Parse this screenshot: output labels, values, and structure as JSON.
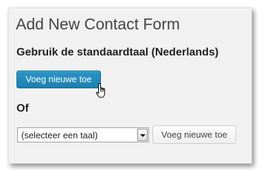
{
  "form": {
    "title": "Add New Contact Form",
    "default_language_label": "Gebruik de standaardtaal (Nederlands)",
    "add_new_primary_label": "Voeg nieuwe toe",
    "or_label": "Of",
    "language_select": {
      "selected_value": "(selecteer een taal)"
    },
    "add_new_secondary_label": "Voeg nieuwe toe"
  },
  "icons": {
    "cursor": "hand-pointer-icon",
    "dropdown": "chevron-down-icon"
  },
  "colors": {
    "primary_button": "#1e81b0",
    "panel_background": "#f1f1f1"
  }
}
